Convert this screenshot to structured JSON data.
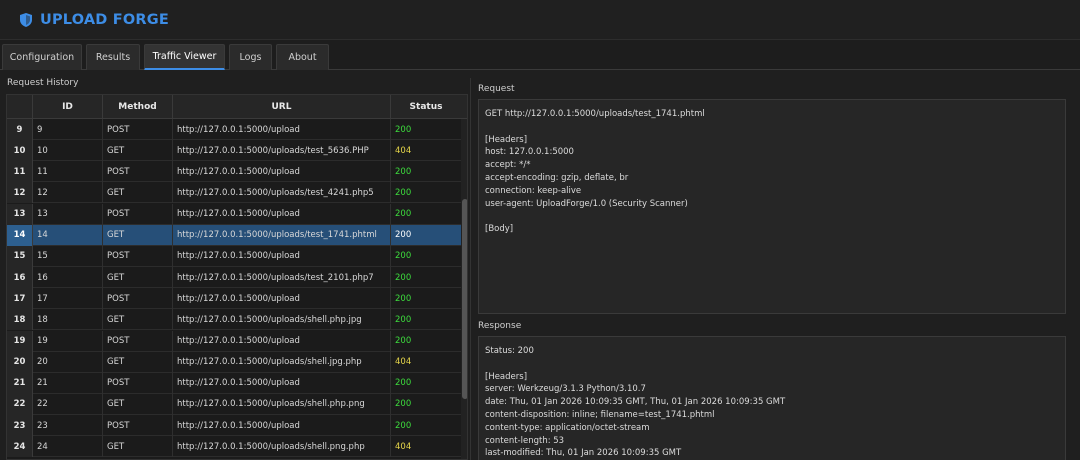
{
  "app": {
    "title": "UPLOAD FORGE"
  },
  "tabs": [
    {
      "label": "Configuration"
    },
    {
      "label": "Results"
    },
    {
      "label": "Traffic Viewer",
      "active": true
    },
    {
      "label": "Logs"
    },
    {
      "label": "About"
    }
  ],
  "history": {
    "label": "Request History",
    "columns": {
      "id": "ID",
      "method": "Method",
      "url": "URL",
      "status": "Status"
    },
    "rows": [
      {
        "n": "9",
        "id": "9",
        "method": "POST",
        "url": "http://127.0.0.1:5000/upload",
        "status": "200"
      },
      {
        "n": "10",
        "id": "10",
        "method": "GET",
        "url": "http://127.0.0.1:5000/uploads/test_5636.PHP",
        "status": "404"
      },
      {
        "n": "11",
        "id": "11",
        "method": "POST",
        "url": "http://127.0.0.1:5000/upload",
        "status": "200"
      },
      {
        "n": "12",
        "id": "12",
        "method": "GET",
        "url": "http://127.0.0.1:5000/uploads/test_4241.php5",
        "status": "200"
      },
      {
        "n": "13",
        "id": "13",
        "method": "POST",
        "url": "http://127.0.0.1:5000/upload",
        "status": "200"
      },
      {
        "n": "14",
        "id": "14",
        "method": "GET",
        "url": "http://127.0.0.1:5000/uploads/test_1741.phtml",
        "status": "200",
        "selected": true
      },
      {
        "n": "15",
        "id": "15",
        "method": "POST",
        "url": "http://127.0.0.1:5000/upload",
        "status": "200"
      },
      {
        "n": "16",
        "id": "16",
        "method": "GET",
        "url": "http://127.0.0.1:5000/uploads/test_2101.php7",
        "status": "200"
      },
      {
        "n": "17",
        "id": "17",
        "method": "POST",
        "url": "http://127.0.0.1:5000/upload",
        "status": "200"
      },
      {
        "n": "18",
        "id": "18",
        "method": "GET",
        "url": "http://127.0.0.1:5000/uploads/shell.php.jpg",
        "status": "200"
      },
      {
        "n": "19",
        "id": "19",
        "method": "POST",
        "url": "http://127.0.0.1:5000/upload",
        "status": "200"
      },
      {
        "n": "20",
        "id": "20",
        "method": "GET",
        "url": "http://127.0.0.1:5000/uploads/shell.jpg.php",
        "status": "404"
      },
      {
        "n": "21",
        "id": "21",
        "method": "POST",
        "url": "http://127.0.0.1:5000/upload",
        "status": "200"
      },
      {
        "n": "22",
        "id": "22",
        "method": "GET",
        "url": "http://127.0.0.1:5000/uploads/shell.php.png",
        "status": "200"
      },
      {
        "n": "23",
        "id": "23",
        "method": "POST",
        "url": "http://127.0.0.1:5000/upload",
        "status": "200"
      },
      {
        "n": "24",
        "id": "24",
        "method": "GET",
        "url": "http://127.0.0.1:5000/uploads/shell.png.php",
        "status": "404"
      }
    ]
  },
  "request": {
    "label": "Request",
    "text": "GET http://127.0.0.1:5000/uploads/test_1741.phtml\n\n[Headers]\nhost: 127.0.0.1:5000\naccept: */*\naccept-encoding: gzip, deflate, br\nconnection: keep-alive\nuser-agent: UploadForge/1.0 (Security Scanner)\n\n[Body]"
  },
  "response": {
    "label": "Response",
    "text": "Status: 200\n\n[Headers]\nserver: Werkzeug/3.1.3 Python/3.10.7\ndate: Thu, 01 Jan 2026 10:09:35 GMT, Thu, 01 Jan 2026 10:09:35 GMT\ncontent-disposition: inline; filename=test_1741.phtml\ncontent-type: application/octet-stream\ncontent-length: 53\nlast-modified: Thu, 01 Jan 2026 10:09:35 GMT"
  },
  "colors": {
    "accent": "#3d8de6",
    "ok": "#3ddc3d",
    "warn": "#e6d64a",
    "selected": "#264f78"
  },
  "icons": {
    "logo": "shield-icon"
  }
}
